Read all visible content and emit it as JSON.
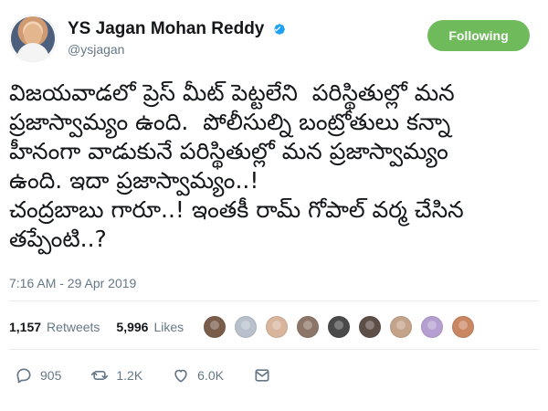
{
  "header": {
    "display_name": "YS Jagan Mohan Reddy",
    "handle": "@ysjagan",
    "follow_button": "Following",
    "accent_color": "#6fba5a"
  },
  "tweet": {
    "text": "విజయవాడలో ప్రెస్ మీట్ పెట్టలేని  పరిస్థితుల్లో మన\nప్రజాస్వామ్యం ఉంది.  పోలీసుల్ని బంట్రోతులు కన్నా\nహీనంగా వాడుకునే పరిస్థితుల్లో మన ప్రజాస్వామ్యం\nఉంది. ఇదా ప్రజాస్వామ్యం..!\nచంద్రబాబు గారూ..! ఇంతకీ రామ్ గోపాల్ వర్మ చేసిన\nతప్పేంటి..?",
    "timestamp": "7:16 AM - 29 Apr 2019"
  },
  "stats": {
    "retweets_count": "1,157",
    "retweets_label": "Retweets",
    "likes_count": "5,996",
    "likes_label": "Likes",
    "liker_avatars": [
      "#7a5c4b",
      "#b8c0cb",
      "#d8b59c",
      "#8c7667",
      "#4a4a4a",
      "#5d4e48",
      "#c3a38a",
      "#b59fd0",
      "#c98662"
    ]
  },
  "actions": {
    "reply_count": "905",
    "retweet_count": "1.2K",
    "like_count": "6.0K",
    "reply_icon": "reply-icon",
    "retweet_icon": "retweet-icon",
    "like_icon": "heart-icon",
    "message_icon": "message-icon"
  }
}
